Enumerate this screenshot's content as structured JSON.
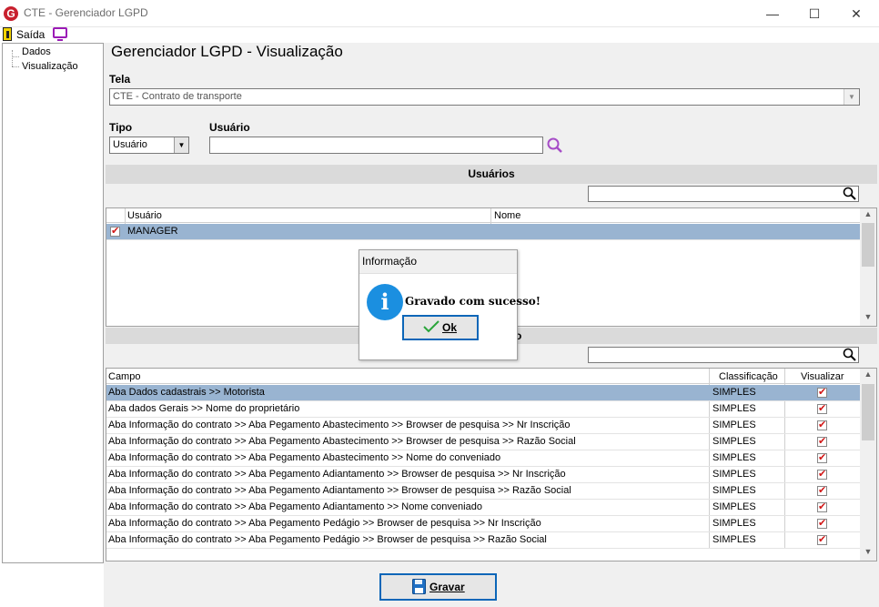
{
  "window": {
    "title": "CTE - Gerenciador LGPD",
    "minimize": "—",
    "maximize": "☐",
    "close": "✕",
    "logo_letter": "G"
  },
  "toolbar": {
    "exit_label": "Saída"
  },
  "tree": {
    "items": [
      "Dados",
      "Visualização"
    ]
  },
  "page": {
    "title": "Gerenciador LGPD - Visualização"
  },
  "form": {
    "tela_label": "Tela",
    "tela_value": "CTE - Contrato de transporte",
    "tipo_label": "Tipo",
    "tipo_value": "Usuário",
    "usuario_label": "Usuário",
    "usuario_value": ""
  },
  "users_section": {
    "title": "Usuários",
    "search_value": "",
    "columns": [
      "Usuário",
      "Nome"
    ],
    "rows": [
      {
        "usuario": "MANAGER",
        "nome": "",
        "checked": true
      }
    ]
  },
  "fields_section": {
    "title_visible": "o",
    "search_value": "",
    "columns": [
      "Campo",
      "Classificação",
      "Visualizar"
    ],
    "rows": [
      {
        "campo": "Aba Dados cadastrais >> Motorista",
        "classificacao": "SIMPLES",
        "visualizar": true
      },
      {
        "campo": "Aba dados Gerais >> Nome do proprietário",
        "classificacao": "SIMPLES",
        "visualizar": true
      },
      {
        "campo": "Aba Informação do contrato >> Aba Pegamento Abastecimento >> Browser de pesquisa >> Nr Inscrição",
        "classificacao": "SIMPLES",
        "visualizar": true
      },
      {
        "campo": "Aba Informação do contrato >> Aba Pegamento Abastecimento >> Browser de pesquisa >> Razão Social",
        "classificacao": "SIMPLES",
        "visualizar": true
      },
      {
        "campo": "Aba Informação do contrato >> Aba Pegamento Abastecimento >> Nome do conveniado",
        "classificacao": "SIMPLES",
        "visualizar": true
      },
      {
        "campo": "Aba Informação do contrato >> Aba Pegamento Adiantamento >> Browser de pesquisa >> Nr Inscrição",
        "classificacao": "SIMPLES",
        "visualizar": true
      },
      {
        "campo": "Aba Informação do contrato >> Aba Pegamento Adiantamento >> Browser de pesquisa >> Razão Social",
        "classificacao": "SIMPLES",
        "visualizar": true
      },
      {
        "campo": "Aba Informação do contrato >> Aba Pegamento Adiantamento >> Nome conveniado",
        "classificacao": "SIMPLES",
        "visualizar": true
      },
      {
        "campo": "Aba Informação do contrato >> Aba Pegamento Pedágio >> Browser de pesquisa >> Nr Inscrição",
        "classificacao": "SIMPLES",
        "visualizar": true
      },
      {
        "campo": "Aba Informação do contrato >> Aba Pegamento Pedágio >> Browser de pesquisa >> Razão Social",
        "classificacao": "SIMPLES",
        "visualizar": true
      }
    ]
  },
  "dialog": {
    "title": "Informação",
    "message": "Gravado com sucesso!",
    "ok_label": "Ok"
  },
  "footer": {
    "save_label": "Gravar"
  },
  "colors": {
    "selection": "#99b4d1",
    "accent": "#0b66b8",
    "check": "#d21717",
    "info": "#1b8fe0"
  }
}
